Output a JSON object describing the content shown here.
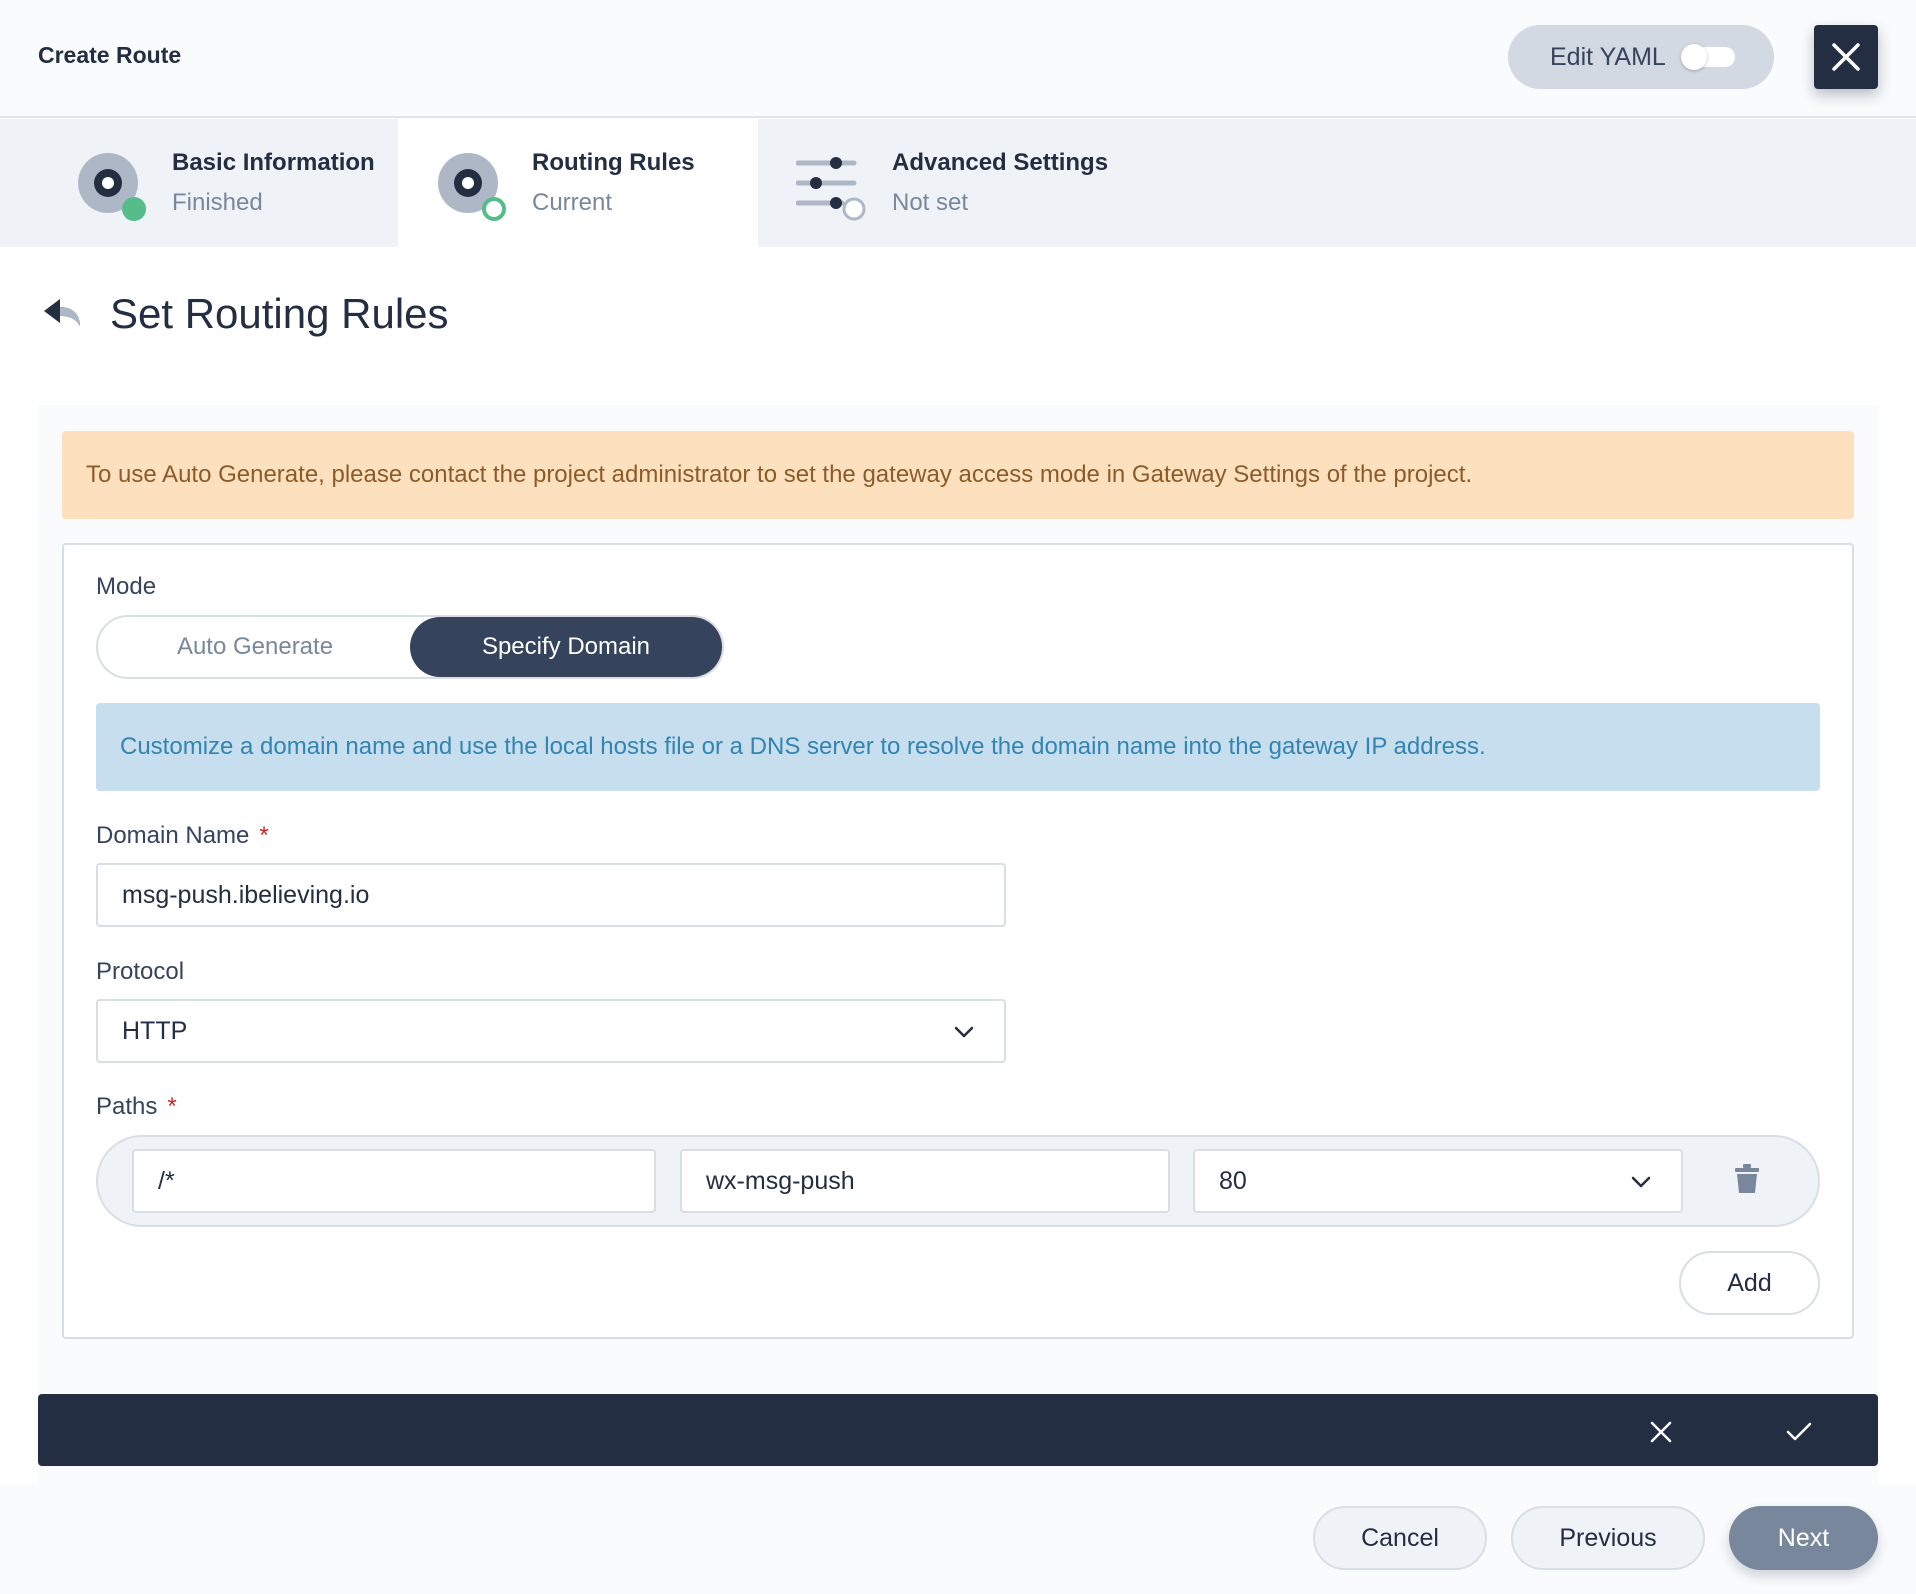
{
  "header": {
    "title": "Create Route",
    "edit_yaml_label": "Edit YAML",
    "edit_yaml_on": false
  },
  "steps": [
    {
      "title": "Basic Information",
      "status": "Finished"
    },
    {
      "title": "Routing Rules",
      "status": "Current"
    },
    {
      "title": "Advanced Settings",
      "status": "Not set"
    }
  ],
  "section": {
    "title": "Set Routing Rules"
  },
  "warning": "To use Auto Generate, please contact the project administrator to set the gateway access mode in Gateway Settings of the project.",
  "form": {
    "mode_label": "Mode",
    "mode_options": [
      "Auto Generate",
      "Specify Domain"
    ],
    "mode_selected": "Specify Domain",
    "info": "Customize a domain name and use the local hosts file or a DNS server to resolve the domain name into the gateway IP address.",
    "domain_label": "Domain Name",
    "required_mark": "*",
    "domain_value": "msg-push.ibelieving.io",
    "protocol_label": "Protocol",
    "protocol_value": "HTTP",
    "paths_label": "Paths",
    "paths": [
      {
        "path": "/*",
        "service": "wx-msg-push",
        "port": "80"
      }
    ],
    "add_label": "Add"
  },
  "footer": {
    "cancel": "Cancel",
    "previous": "Previous",
    "next": "Next"
  },
  "colors": {
    "dark": "#242e42",
    "success": "#55bc8a",
    "warning_bg": "#fde1bf",
    "info_bg": "#c7deef",
    "required": "#ca2621"
  }
}
